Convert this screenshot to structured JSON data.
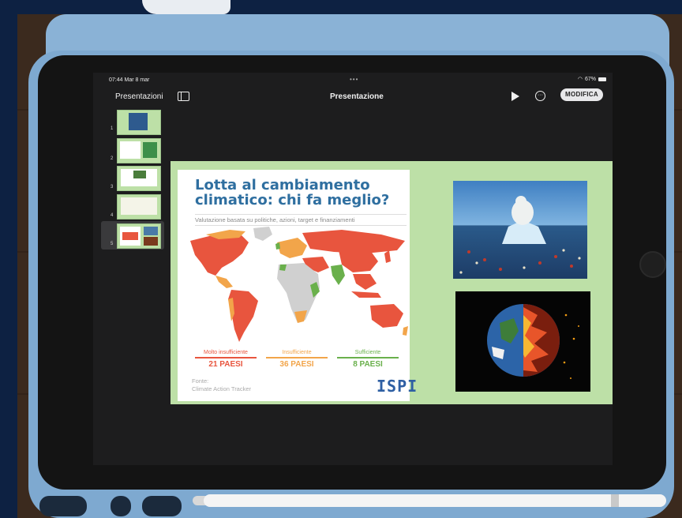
{
  "statusbar": {
    "time": "07:44",
    "date": "Mar 8 mar",
    "dots": "•••",
    "battery": "67%"
  },
  "toolbar": {
    "back_label": "Presentazioni",
    "title": "Presentazione",
    "edit_label": "MODIFICA"
  },
  "slides_nav": {
    "items": [
      {
        "number": "1"
      },
      {
        "number": "2"
      },
      {
        "number": "3"
      },
      {
        "number": "4"
      },
      {
        "number": "5"
      }
    ],
    "selected_index": 5
  },
  "slide": {
    "title": "Lotta al cambiamento climatico: chi fa meglio?",
    "subtitle": "Valutazione basata su politiche, azioni, target e finanziamenti",
    "legend": [
      {
        "label": "Molto insufficiente",
        "count": "21 PAESI",
        "color": "#e8553e"
      },
      {
        "label": "Insufficiente",
        "count": "36 PAESI",
        "color": "#f2a54a"
      },
      {
        "label": "Sufficiente",
        "count": "8 PAESI",
        "color": "#6ab04c"
      }
    ],
    "source_label": "Fonte:",
    "source": "Climate Action Tracker",
    "logo": "ISPI"
  },
  "colors": {
    "slide_bg": "#bde0a7",
    "title_blue": "#2f6fa0",
    "very_insufficient": "#e8553e",
    "insufficient": "#f2a54a",
    "sufficient": "#6ab04c",
    "no_data": "#d0d0d0"
  },
  "icons": [
    "sidebar-toggle-icon",
    "play-icon",
    "more-icon",
    "wifi-icon",
    "battery-icon"
  ]
}
